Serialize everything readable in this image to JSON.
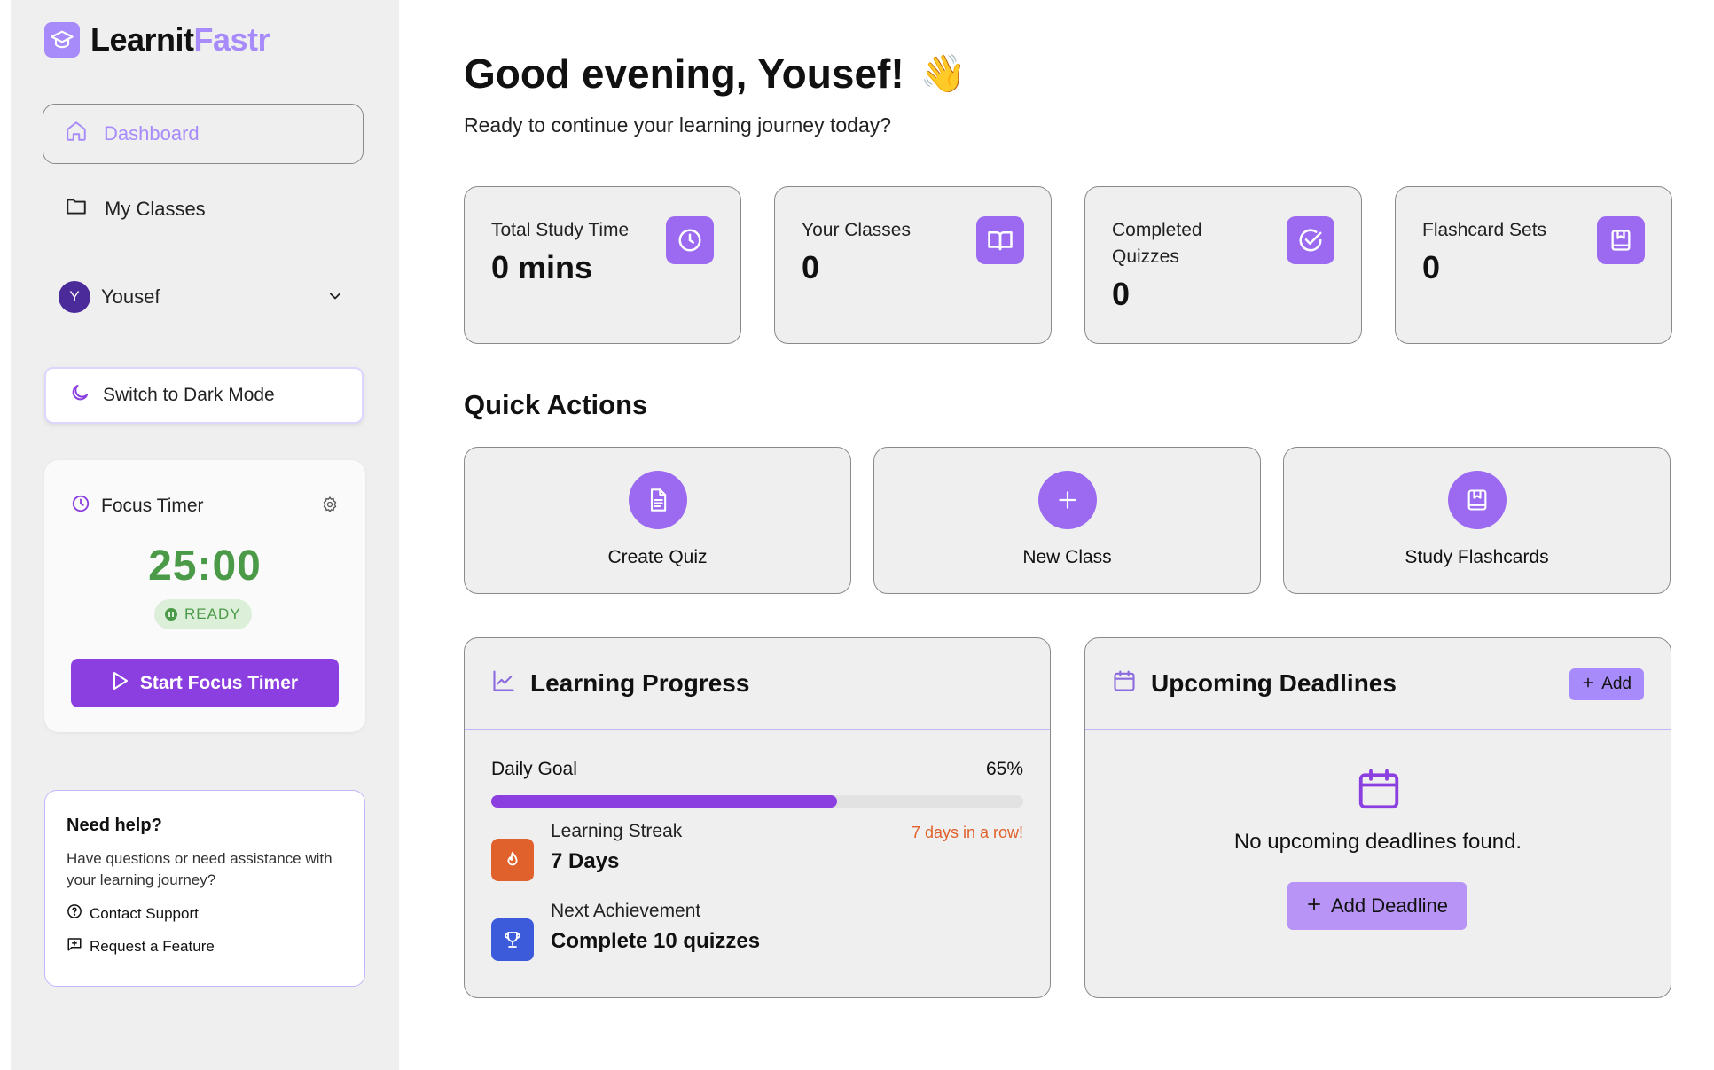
{
  "app": {
    "name_part1": "Learnit",
    "name_part2": "Fastr"
  },
  "sidebar": {
    "nav": [
      {
        "label": "Dashboard",
        "icon": "home-icon",
        "active": true
      },
      {
        "label": "My Classes",
        "icon": "folder-icon",
        "active": false
      }
    ],
    "user": {
      "initial": "Y",
      "name": "Yousef"
    },
    "dark_mode_label": "Switch to Dark Mode",
    "focus_timer": {
      "title": "Focus Timer",
      "time": "25:00",
      "status": "READY",
      "start_label": "Start Focus Timer"
    },
    "help": {
      "title": "Need help?",
      "description": "Have questions or need assistance with your learning journey?",
      "contact_label": "Contact Support",
      "feature_label": "Request a Feature"
    }
  },
  "main": {
    "greeting": "Good evening, Yousef!",
    "greeting_emoji": "👋",
    "subtitle": "Ready to continue your learning journey today?",
    "stats": [
      {
        "label": "Total Study Time",
        "value": "0 mins",
        "icon": "clock-icon"
      },
      {
        "label": "Your Classes",
        "value": "0",
        "icon": "book-open-icon"
      },
      {
        "label": "Completed Quizzes",
        "value": "0",
        "icon": "check-circle-icon"
      },
      {
        "label": "Flashcard Sets",
        "value": "0",
        "icon": "bookmark-book-icon"
      }
    ],
    "quick_actions_title": "Quick Actions",
    "quick_actions": [
      {
        "label": "Create Quiz",
        "icon": "document-icon"
      },
      {
        "label": "New Class",
        "icon": "plus-icon"
      },
      {
        "label": "Study Flashcards",
        "icon": "bookmark-book-icon"
      }
    ],
    "progress": {
      "title": "Learning Progress",
      "daily_goal_label": "Daily Goal",
      "daily_goal_percent_text": "65%",
      "daily_goal_fraction": 0.65,
      "streak_label": "Learning Streak",
      "streak_value": "7 Days",
      "streak_note": "7 days in a row!",
      "achievement_label": "Next Achievement",
      "achievement_value": "Complete 10 quizzes"
    },
    "deadlines": {
      "title": "Upcoming Deadlines",
      "add_label": "Add",
      "empty_text": "No upcoming deadlines found.",
      "add_deadline_label": "Add Deadline"
    }
  },
  "colors": {
    "accent": "#a78bfa",
    "primary_button": "#8b3fe0",
    "timer_green": "#4a9a48",
    "streak_orange": "#e0612b",
    "achievement_blue": "#3b5bdb"
  }
}
